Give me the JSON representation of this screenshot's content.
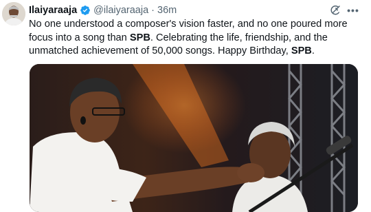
{
  "author": {
    "name": "Ilaiyaraaja",
    "handle": "@ilaiyaraaja",
    "separator": "·",
    "time": "36m",
    "verified": true
  },
  "tweet": {
    "seg1": "No one understood a composer's vision faster, and no one poured more focus into a song than ",
    "bold1": "SPB",
    "seg2": ". Celebrating the life, friendship, and the unmatched achievement of 50,000 songs. Happy Birthday, ",
    "bold2": "SPB",
    "seg3": "."
  },
  "icons": {
    "verified": "verified-badge-icon",
    "grok": "grok-icon",
    "more": "more-icon"
  },
  "colors": {
    "verified_blue": "#1d9bf0",
    "muted_text": "#536471"
  },
  "more_glyph": "•••"
}
